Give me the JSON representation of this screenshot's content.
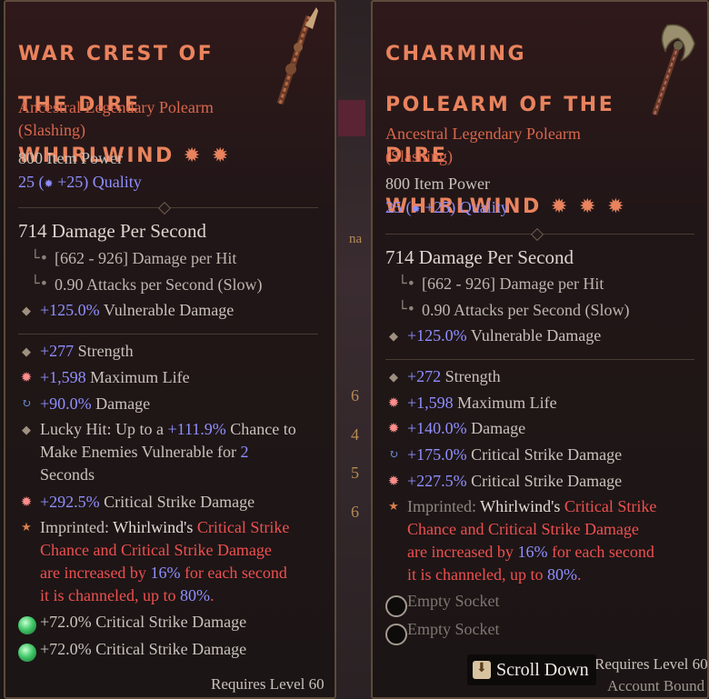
{
  "left": {
    "title": "War Crest of the Dire Whirlwind",
    "title_lines": [
      "War Crest of",
      "the Dire",
      "Whirlwind ✹ ✹"
    ],
    "type_line1": "Ancestral Legendary Polearm",
    "type_line2": "(Slashing)",
    "item_power": "800 Item Power",
    "quality_base": "25 (",
    "quality_bonus": "+25)",
    "quality_label": "Quality",
    "dps": "714 Damage Per Second",
    "damage_per_hit": "[662 - 926] Damage per Hit",
    "attacks_per_second": "0.90 Attacks per Second (Slow)",
    "implicit_value": "+125.0%",
    "implicit_label": "Vulnerable Damage",
    "affixes": [
      {
        "icon": "diamond",
        "value": "+277",
        "label": "Strength"
      },
      {
        "icon": "star",
        "value": "+1,598",
        "label": "Maximum Life"
      },
      {
        "icon": "swirl",
        "value": "+90.0%",
        "label": "Damage"
      },
      {
        "icon": "diamond",
        "lines": [
          "Lucky Hit: Up to a ",
          "+111.9%",
          " Chance to",
          "Make Enemies Vulnerable for ",
          "2",
          "Seconds"
        ]
      },
      {
        "icon": "star",
        "value": "+292.5%",
        "label": "Critical Strike Damage"
      }
    ],
    "imprint": {
      "prefix": "Imprinted: ",
      "skill": "Whirlwind's ",
      "l1_red": "Critical Strike",
      "l2": "Chance and Critical Strike Damage",
      "l3a": "are increased by ",
      "l3b": "16%",
      "l3c": " for each second",
      "l4a": "it is channeled, up to ",
      "l4b": "80%",
      "l4c": "."
    },
    "gems": [
      "+72.0% Critical Strike Damage",
      "+72.0% Critical Strike Damage"
    ],
    "requires": "Requires Level 60"
  },
  "right": {
    "title": "Charming Polearm of the Dire Whirlwind",
    "title_lines": [
      "Charming",
      "Polearm of the",
      "Dire",
      "Whirlwind ✹ ✹ ✹"
    ],
    "type_line1": "Ancestral Legendary Polearm",
    "type_line2": "(Slashing)",
    "item_power": "800 Item Power",
    "quality_base": "25 (",
    "quality_bonus": "+25)",
    "quality_label": "Quality",
    "dps": "714 Damage Per Second",
    "damage_per_hit": "[662 - 926] Damage per Hit",
    "attacks_per_second": "0.90 Attacks per Second (Slow)",
    "implicit_value": "+125.0%",
    "implicit_label": "Vulnerable Damage",
    "affixes": [
      {
        "icon": "diamond",
        "value": "+272",
        "label": "Strength"
      },
      {
        "icon": "star",
        "value": "+1,598",
        "label": "Maximum Life"
      },
      {
        "icon": "star",
        "value": "+140.0%",
        "label": "Damage"
      },
      {
        "icon": "swirl",
        "value": "+175.0%",
        "label": "Critical Strike Damage"
      },
      {
        "icon": "star",
        "value": "+227.5%",
        "label": "Critical Strike Damage"
      }
    ],
    "imprint": {
      "prefix": "Imprinted: ",
      "skill": "Whirlwind's ",
      "l1_red": "Critical Strike",
      "l2": "Chance and Critical Strike Damage",
      "l3a": "are increased by ",
      "l3b": "16%",
      "l3c": " for each second",
      "l4a": "it is channeled, up to ",
      "l4b": "80%",
      "l4c": "."
    },
    "sockets": [
      "Empty Socket",
      "Empty Socket"
    ],
    "requires": "Requires Level 60",
    "account_bound": "Account Bound"
  },
  "scroll_hint": {
    "label": "Scroll Down",
    "icon": "scroll-down-key-icon"
  },
  "background_glyphs": [
    "na",
    "6",
    "4",
    "5",
    "6"
  ]
}
